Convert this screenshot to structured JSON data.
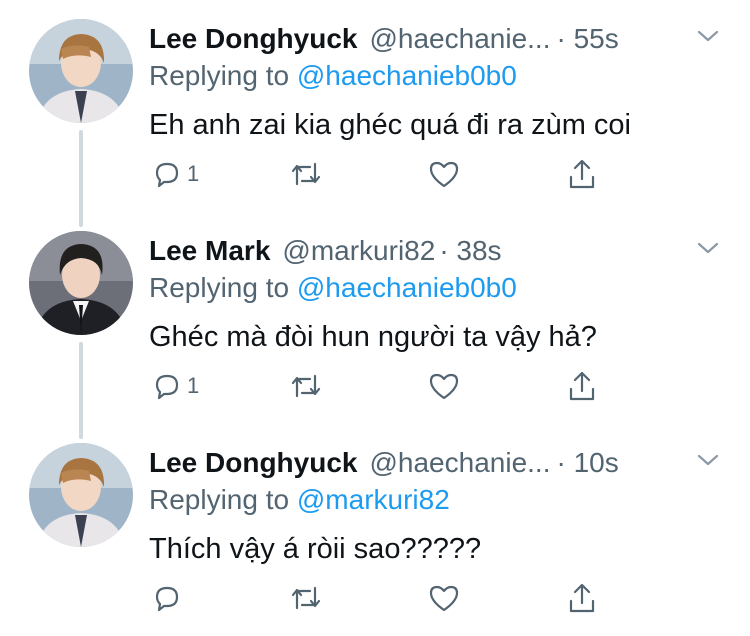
{
  "colors": {
    "text": "#0f1419",
    "muted": "#536471",
    "link": "#1d9bf0",
    "thread": "#cfd9de"
  },
  "tweets": [
    {
      "name": "Lee Donghyuck",
      "handle": "@haechanie...",
      "time": "· 55s",
      "reply_prefix": "Replying to",
      "reply_to": "@haechanieb0b0",
      "text": "Eh anh zai kia ghéc quá đi ra zùm coi",
      "reply_count": "1",
      "icons": [
        "reply-icon",
        "retweet-icon",
        "like-icon",
        "share-icon"
      ]
    },
    {
      "name": "Lee Mark",
      "handle": "@markuri82",
      "time": "· 38s",
      "reply_prefix": "Replying to",
      "reply_to": "@haechanieb0b0",
      "text": "Ghéc mà đòi hun người ta vậy hả?",
      "reply_count": "1",
      "icons": [
        "reply-icon",
        "retweet-icon",
        "like-icon",
        "share-icon"
      ]
    },
    {
      "name": "Lee Donghyuck",
      "handle": "@haechanie...",
      "time": "· 10s",
      "reply_prefix": "Replying to",
      "reply_to": "@markuri82",
      "text": "Thích vậy á ròii sao?????",
      "reply_count": "",
      "icons": [
        "reply-icon",
        "retweet-icon",
        "like-icon",
        "share-icon"
      ]
    }
  ]
}
